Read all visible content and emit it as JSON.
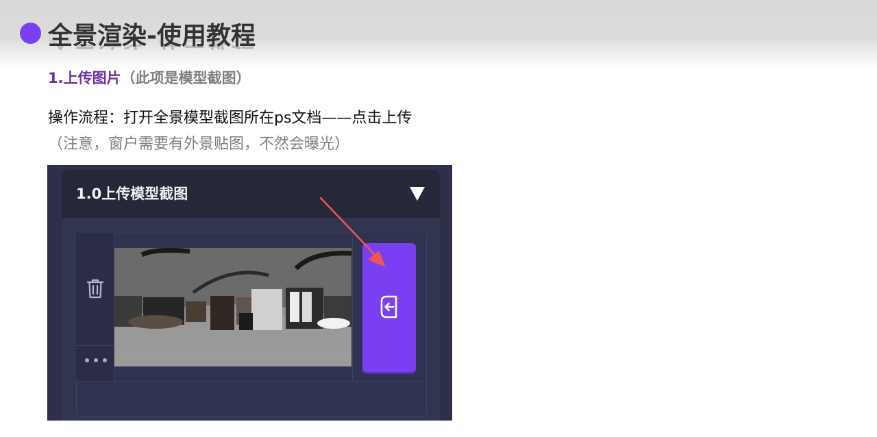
{
  "heading": {
    "title": "全景渲染-使用教程",
    "bullet_color": "#7a3ff0"
  },
  "section": {
    "number_label": "1.上传图片",
    "note": "（此项是模型截图）"
  },
  "instructions": {
    "line1": "操作流程：打开全景模型截图所在ps文档——点击上传",
    "line2": "（注意，窗户需要有外景贴图，不然会曝光）"
  },
  "screenshot": {
    "panel_title": "1.0上传模型截图",
    "icons": {
      "collapse": "triangle-down-icon",
      "delete": "trash-icon",
      "more": "more-dots-icon",
      "upload": "upload-import-icon",
      "pointer": "red-arrow"
    },
    "accent_color": "#7b3ff2",
    "arrow_color": "#f05454"
  }
}
